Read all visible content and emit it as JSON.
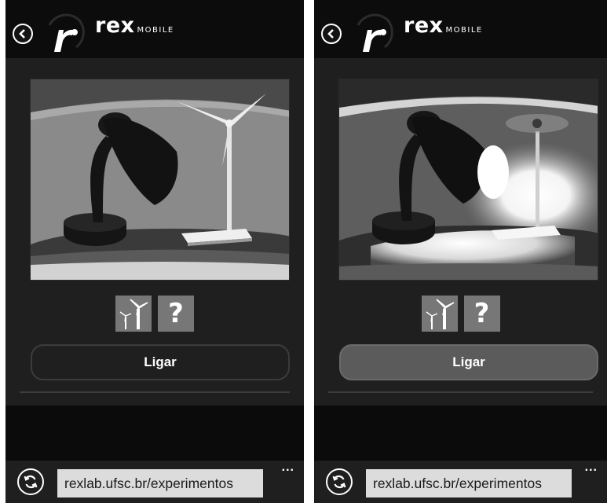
{
  "screens": [
    {
      "id": "off",
      "header": {
        "brand_main": "rex",
        "brand_sub": "MOBILE",
        "back_icon": "back-arrow-icon",
        "logo_icon": "rex-logo-icon"
      },
      "camera": {
        "state": "lamp-off",
        "scene": "desk-lamp-and-wind-turbine"
      },
      "tools": [
        {
          "icon": "wind-turbine-icon"
        },
        {
          "icon": "help-icon",
          "label": "?"
        }
      ],
      "action": {
        "label": "Ligar",
        "active": false
      },
      "addressbar": {
        "refresh_icon": "refresh-icon",
        "url": "rexlab.ufsc.br/experimentos",
        "more": "..."
      }
    },
    {
      "id": "on",
      "header": {
        "brand_main": "rex",
        "brand_sub": "MOBILE",
        "back_icon": "back-arrow-icon",
        "logo_icon": "rex-logo-icon"
      },
      "camera": {
        "state": "lamp-on",
        "scene": "desk-lamp-and-wind-turbine"
      },
      "tools": [
        {
          "icon": "wind-turbine-icon"
        },
        {
          "icon": "help-icon",
          "label": "?"
        }
      ],
      "action": {
        "label": "Ligar",
        "active": true
      },
      "addressbar": {
        "refresh_icon": "refresh-icon",
        "url": "rexlab.ufsc.br/experimentos",
        "more": "..."
      }
    }
  ],
  "colors": {
    "screen_bg": "#1d1d1d",
    "header_bg": "#0c0c0c",
    "button_inactive": "#1f1f1f",
    "button_active": "#5b5b5b",
    "tile_bg": "#777777",
    "url_field_bg": "#dcdcdc"
  }
}
